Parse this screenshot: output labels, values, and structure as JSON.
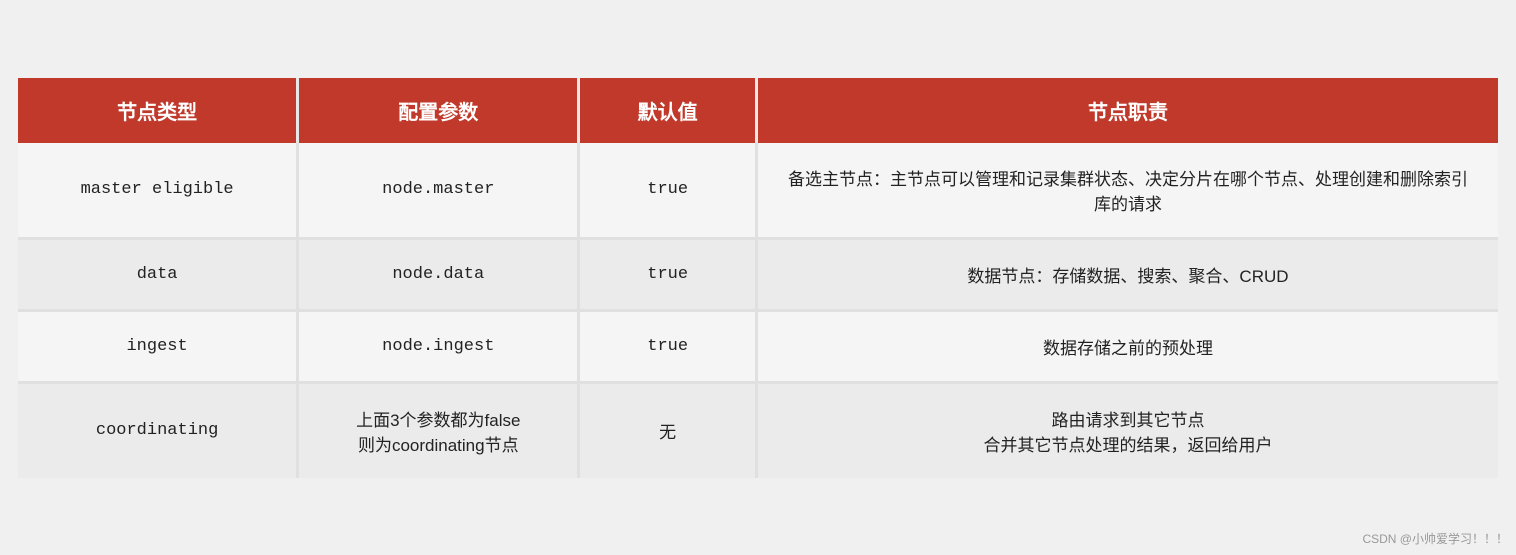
{
  "table": {
    "headers": {
      "col1": "节点类型",
      "col2": "配置参数",
      "col3": "默认值",
      "col4": "节点职责"
    },
    "rows": [
      {
        "type": "master eligible",
        "param": "node.master",
        "default": "true",
        "desc": "备选主节点：主节点可以管理和记录集群状态、决定分片在哪个节点、处理创建和删除索引库的请求"
      },
      {
        "type": "data",
        "param": "node.data",
        "default": "true",
        "desc": "数据节点：存储数据、搜索、聚合、CRUD"
      },
      {
        "type": "ingest",
        "param": "node.ingest",
        "default": "true",
        "desc": "数据存储之前的预处理"
      },
      {
        "type": "coordinating",
        "param_line1": "上面3个参数都为false",
        "param_line2": "则为coordinating节点",
        "default": "无",
        "desc_line1": "路由请求到其它节点",
        "desc_line2": "合并其它节点处理的结果，返回给用户"
      }
    ],
    "watermark": "CSDN @小帅爱学习！！！"
  }
}
